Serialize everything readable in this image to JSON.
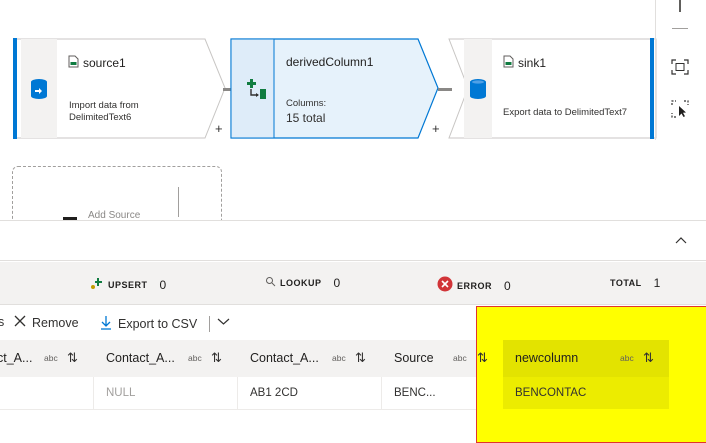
{
  "flow": {
    "nodes": [
      {
        "id": "source1",
        "title": "source1",
        "desc_line1": "Import data from",
        "desc_line2": "DelimitedText6",
        "icon": "dataset-icon"
      },
      {
        "id": "derivedColumn1",
        "title": "derivedColumn1",
        "desc_line1": "Columns:",
        "desc_line2": "15 total",
        "icon": "derived-column-icon"
      },
      {
        "id": "sink1",
        "title": "sink1",
        "desc_line1": "Export data to DelimitedText7",
        "icon": "dataset-icon"
      }
    ],
    "plus_label": "+",
    "add_source_label": "Add Source"
  },
  "stats": {
    "upsert_label": "UPSERT",
    "upsert_value": "0",
    "lookup_label": "LOOKUP",
    "lookup_value": "0",
    "error_label": "ERROR",
    "error_value": "0",
    "total_label": "TOTAL",
    "total_value": "1"
  },
  "toolbar": {
    "partial_label": "s",
    "remove_label": "Remove",
    "export_label": "Export to CSV"
  },
  "grid": {
    "columns": [
      {
        "label": "ct_A...",
        "type": "abc"
      },
      {
        "label": "Contact_A...",
        "type": "abc"
      },
      {
        "label": "Contact_A...",
        "type": "abc"
      },
      {
        "label": "Source",
        "type": "abc"
      },
      {
        "label": "newcolumn",
        "type": "abc"
      }
    ],
    "row": [
      "",
      "NULL",
      "AB1 2CD",
      "BENC...",
      "BENCONTAC"
    ]
  },
  "colors": {
    "accent": "#0078d4",
    "highlight": "#ffff00",
    "selected_node": "#e6f2fb"
  }
}
